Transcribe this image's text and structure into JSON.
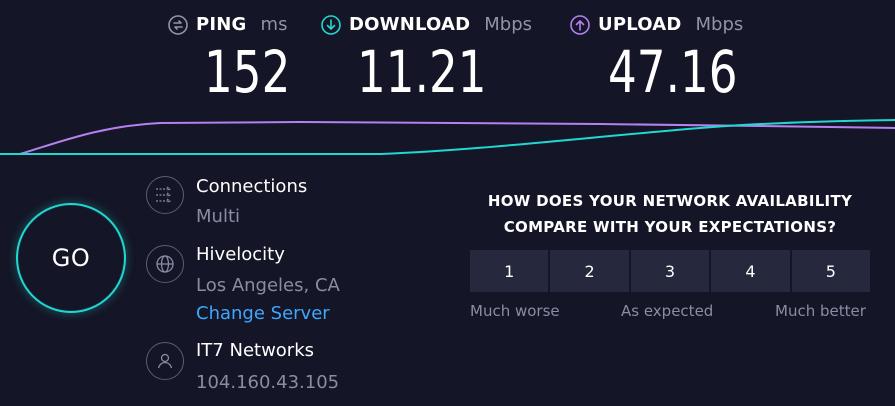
{
  "metrics": {
    "ping": {
      "label": "PING",
      "unit": "ms",
      "value": "152",
      "color": "#9193a8"
    },
    "download": {
      "label": "DOWNLOAD",
      "unit": "Mbps",
      "value": "11.21",
      "color": "#22d7d0"
    },
    "upload": {
      "label": "UPLOAD",
      "unit": "Mbps",
      "value": "47.16",
      "color": "#b580f0"
    }
  },
  "go_button": {
    "label": "GO"
  },
  "connections": {
    "title": "Connections",
    "value": "Multi"
  },
  "server": {
    "name": "Hivelocity",
    "location": "Los Angeles, CA",
    "change_link": "Change Server"
  },
  "provider": {
    "name": "IT7 Networks",
    "ip": "104.160.43.105"
  },
  "survey": {
    "question_line1": "HOW DOES YOUR NETWORK AVAILABILITY",
    "question_line2": "COMPARE WITH YOUR EXPECTATIONS?",
    "options": [
      "1",
      "2",
      "3",
      "4",
      "5"
    ],
    "label_low": "Much worse",
    "label_mid": "As expected",
    "label_high": "Much better"
  },
  "colors": {
    "background": "#141526",
    "download_line": "#22d7d0",
    "upload_line": "#b580f0",
    "link": "#3fa7ff"
  }
}
